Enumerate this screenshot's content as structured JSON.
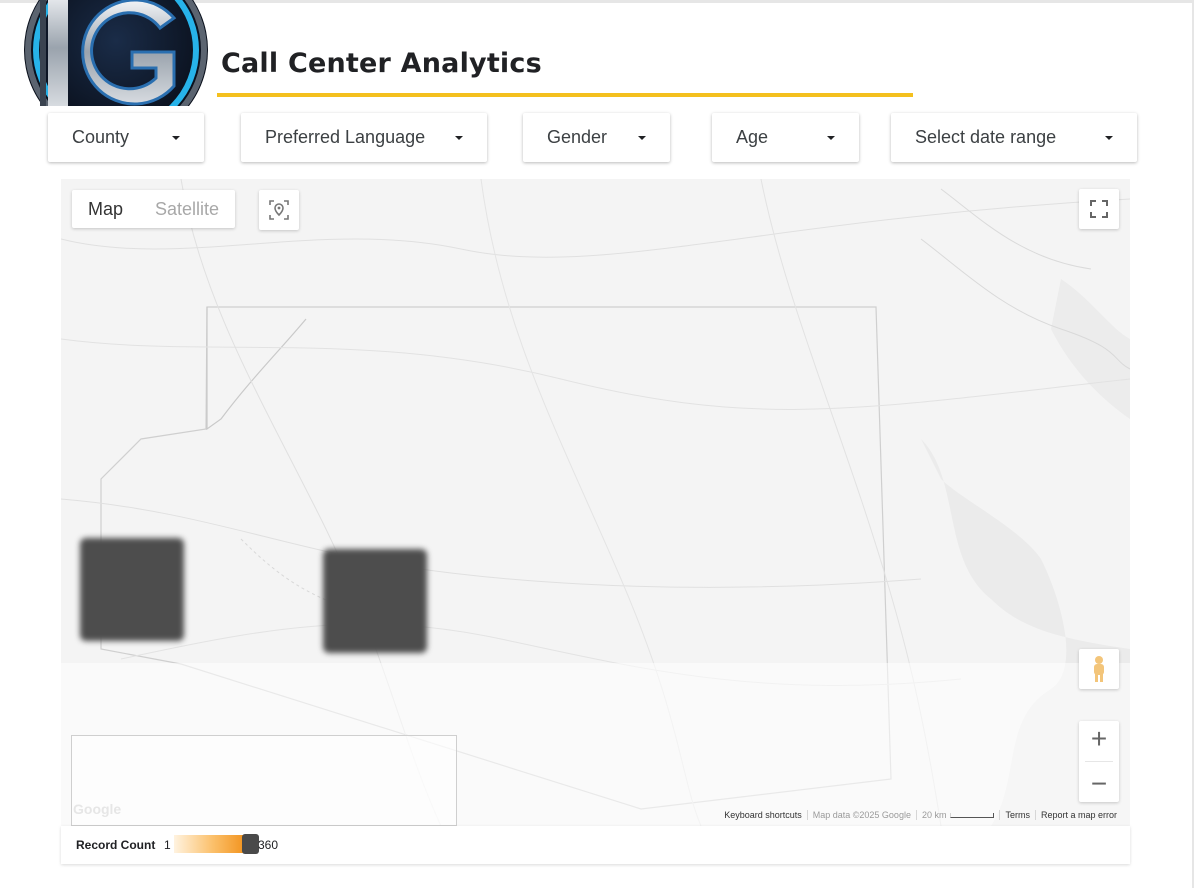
{
  "header": {
    "title": "Call Center Analytics",
    "accent_color": "#f4c01e",
    "logo_icon": "ig-logo-icon"
  },
  "filters": [
    {
      "label": "County"
    },
    {
      "label": "Preferred Language"
    },
    {
      "label": "Gender"
    },
    {
      "label": "Age"
    },
    {
      "label": "Select date range"
    }
  ],
  "map": {
    "map_type": {
      "map": "Map",
      "satellite": "Satellite"
    },
    "active_map_type": "Map",
    "google_mark": "Google",
    "attribution": {
      "shortcuts": "Keyboard shortcuts",
      "data": "Map data ©2025 Google",
      "scale": "20 km",
      "terms": "Terms",
      "report": "Report a map error"
    },
    "icons": [
      "location-icon",
      "fullscreen-icon",
      "pegman-icon",
      "zoom-in-icon",
      "zoom-out-icon"
    ]
  },
  "legend": {
    "label": "Record Count",
    "min": "1",
    "max": "360",
    "gradient_colors": [
      "#fff3e0",
      "#f2921c",
      "#4a4a4a"
    ]
  }
}
